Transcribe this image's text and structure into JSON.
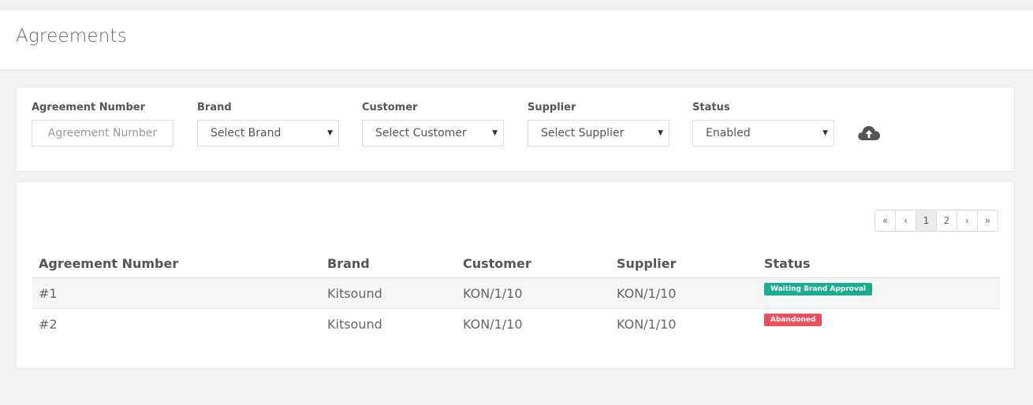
{
  "page": {
    "title": "Agreements"
  },
  "filters": {
    "agreement_number": {
      "label": "Agreement Number",
      "placeholder": "Agreement Number"
    },
    "brand": {
      "label": "Brand",
      "value": "Select Brand"
    },
    "customer": {
      "label": "Customer",
      "value": "Select Customer"
    },
    "supplier": {
      "label": "Supplier",
      "value": "Select Supplier"
    },
    "status": {
      "label": "Status",
      "value": "Enabled"
    },
    "upload_icon": "cloud-upload-icon"
  },
  "pagination": {
    "first": "«",
    "prev": "‹",
    "pages": [
      "1",
      "2"
    ],
    "current": "1",
    "next": "›",
    "last": "»"
  },
  "table": {
    "columns": [
      "Agreement Number",
      "Brand",
      "Customer",
      "Supplier",
      "Status"
    ],
    "rows": [
      {
        "number": "#1",
        "brand": "Kitsound",
        "customer": "KON/1/10",
        "supplier": "KON/1/10",
        "status": "Waiting Brand Approval",
        "status_color": "#1aae8f"
      },
      {
        "number": "#2",
        "brand": "Kitsound",
        "customer": "KON/1/10",
        "supplier": "KON/1/10",
        "status": "Abandoned",
        "status_color": "#e8505b"
      }
    ]
  }
}
